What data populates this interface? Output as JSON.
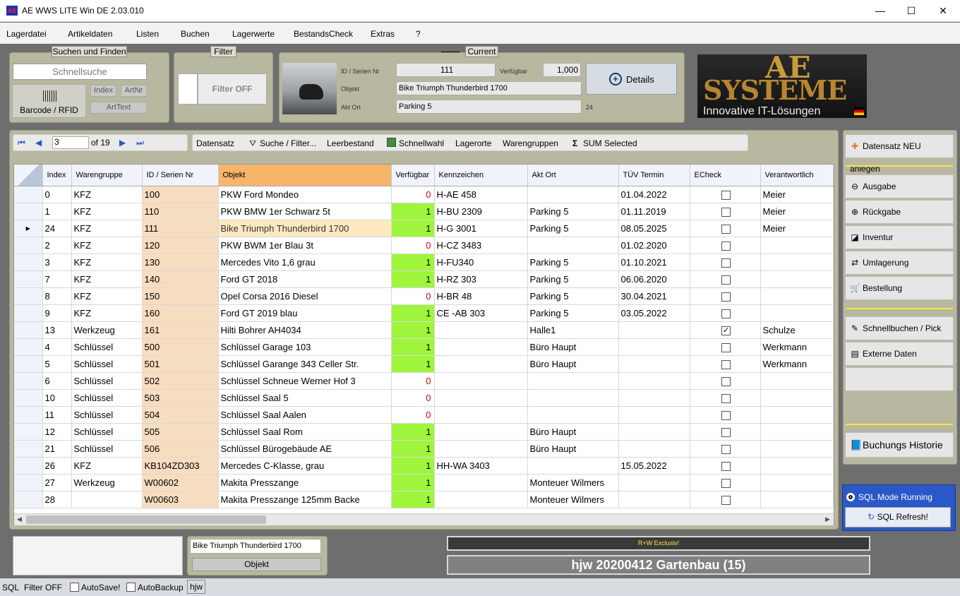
{
  "window": {
    "app_icon": "AE",
    "title": "AE WWS LITE Win DE 2.03.010",
    "minimize": "—",
    "maximize": "☐",
    "close": "✕"
  },
  "menu": [
    "Lagerdatei",
    "Artikeldaten",
    "Listen",
    "Buchen",
    "Lagerwerte",
    "BestandsCheck",
    "Extras",
    "?"
  ],
  "search": {
    "title": "Suchen und Finden",
    "quick_search": "Schnellsuche",
    "barcode": "Barcode / RFID",
    "index": "Index",
    "artnr": "ArtNr",
    "arttext": "ArtText"
  },
  "filter": {
    "title": "Filter",
    "label": "Filter OFF"
  },
  "current": {
    "title": "Current",
    "id_label": "ID / Serien Nr",
    "id_value": "111",
    "available_label": "Verfügbar",
    "available_value": "1,000",
    "object_label": "Objekt",
    "object_value": "Bike Triumph Thunderbird 1700",
    "location_label": "Akt Ort",
    "location_value": "Parking 5",
    "location_count": "24",
    "details": "Details"
  },
  "logo": {
    "line1": "AE",
    "line2": "SYSTEME",
    "tagline": "Innovative IT-Lösungen"
  },
  "nav": {
    "record": "3",
    "of": "of 19"
  },
  "toolbar": {
    "datensatz": "Datensatz",
    "suche": "Suche / Filter...",
    "leerbestand": "Leerbestand",
    "schnellwahl": "Schnellwahl",
    "lagerorte": "Lagerorte",
    "warengruppen": "Warengruppen",
    "sum": "SUM Selected"
  },
  "grid": {
    "headers": [
      "Index",
      "Warengruppe",
      "ID / Serien Nr",
      "Objekt",
      "Verfügbar",
      "Kennzeichen",
      "Akt Ort",
      "TÜV Termin",
      "ECheck",
      "Verantwortlich"
    ],
    "rows": [
      [
        "0",
        "KFZ",
        "100",
        "PKW Ford Mondeo",
        "0",
        "H-AE 458",
        "",
        "01.04.2022",
        false,
        "Meier"
      ],
      [
        "1",
        "KFZ",
        "110",
        "PKW BMW 1er Schwarz 5t",
        "1",
        "H-BU 2309",
        "Parking 5",
        "01.11.2019",
        false,
        "Meier"
      ],
      [
        "24",
        "KFZ",
        "111",
        "Bike Triumph Thunderbird 1700",
        "1",
        "H-G 3001",
        "Parking 5",
        "08.05.2025",
        false,
        "Meier"
      ],
      [
        "2",
        "KFZ",
        "120",
        "PKW BWM 1er Blau 3t",
        "0",
        "H-CZ 3483",
        "",
        "01.02.2020",
        false,
        ""
      ],
      [
        "3",
        "KFZ",
        "130",
        "Mercedes Vito 1,6 grau",
        "1",
        "H-FU340",
        "Parking 5",
        "01.10.2021",
        false,
        ""
      ],
      [
        "7",
        "KFZ",
        "140",
        "Ford GT 2018",
        "1",
        "H-RZ 303",
        "Parking 5",
        "06.06.2020",
        false,
        ""
      ],
      [
        "8",
        "KFZ",
        "150",
        "Opel Corsa 2016 Diesel",
        "0",
        "H-BR 48",
        "Parking 5",
        "30.04.2021",
        false,
        ""
      ],
      [
        "9",
        "KFZ",
        "160",
        "Ford GT 2019 blau",
        "1",
        "CE -AB 303",
        "Parking 5",
        "03.05.2022",
        false,
        ""
      ],
      [
        "13",
        "Werkzeug",
        "161",
        "Hilti Bohrer AH4034",
        "1",
        "",
        "Halle1",
        "",
        true,
        "Schulze"
      ],
      [
        "4",
        "Schlüssel",
        "500",
        "Schlüssel Garage 103",
        "1",
        "",
        "Büro Haupt",
        "",
        false,
        "Werkmann"
      ],
      [
        "5",
        "Schlüssel",
        "501",
        "Schlüssel Garange 343 Celler Str.",
        "1",
        "",
        "Büro Haupt",
        "",
        false,
        "Werkmann"
      ],
      [
        "6",
        "Schlüssel",
        "502",
        "Schlüssel Schneue Werner Hof 3",
        "0",
        "",
        "",
        "",
        false,
        ""
      ],
      [
        "10",
        "Schlüssel",
        "503",
        "Schlüssel Saal 5",
        "0",
        "",
        "",
        "",
        false,
        ""
      ],
      [
        "11",
        "Schlüssel",
        "504",
        "Schlüssel Saal Aalen",
        "0",
        "",
        "",
        "",
        false,
        ""
      ],
      [
        "12",
        "Schlüssel",
        "505",
        "Schlüssel Saal Rom",
        "1",
        "",
        "Büro Haupt",
        "",
        false,
        ""
      ],
      [
        "21",
        "Schlüssel",
        "506",
        "Schlüssel Bürogebäude AE",
        "1",
        "",
        "Büro Haupt",
        "",
        false,
        ""
      ],
      [
        "26",
        "KFZ",
        "KB104ZD303",
        "Mercedes C-Klasse, grau",
        "1",
        "HH-WA 3403",
        "",
        "15.05.2022",
        false,
        ""
      ],
      [
        "27",
        "Werkzeug",
        "W00602",
        "Makita Presszange",
        "1",
        "",
        "Monteuer Wilmers",
        "",
        false,
        ""
      ],
      [
        "28",
        "",
        "W00603",
        "Makita Presszange 125mm Backe",
        "1",
        "",
        "Monteuer Wilmers",
        "",
        false,
        ""
      ]
    ],
    "selected_row": 2
  },
  "side": {
    "neu": "Datensatz NEU anlegen",
    "ausgabe": "Ausgabe",
    "rueckgabe": "Rückgabe",
    "inventur": "Inventur",
    "umlagerung": "Umlagerung",
    "bestellung": "Bestellung",
    "schnellbuchen": "Schnellbuchen / Pick List",
    "extern": "Externe Daten",
    "historie": "Buchungs Historie"
  },
  "sql": {
    "mode": "SQL Mode Running",
    "refresh": "SQL Refresh!"
  },
  "bottom": {
    "object_value": "Bike Triumph Thunderbird 1700",
    "object_button": "Objekt",
    "exclusive": "R+W Exclusiv!",
    "db_name": "hjw 20200412 Gartenbau (15)"
  },
  "status": {
    "sql": "SQL",
    "filter": "Filter OFF",
    "autosave": "AutoSave!",
    "autobackup": "AutoBackup",
    "user": "hjw"
  },
  "colors": {
    "available_green": "#9ff53b",
    "id_column": "#f7ddbf",
    "zero_red": "#e00000",
    "panel": "#b8b8a0",
    "accent_blue": "#2a58c8"
  }
}
